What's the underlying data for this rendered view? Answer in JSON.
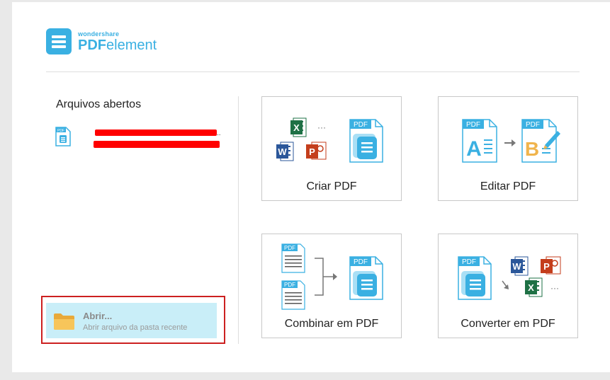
{
  "logo": {
    "brand_sub": "wondershare",
    "brand_main_prefix": "PDF",
    "brand_main_suffix": "element"
  },
  "recent": {
    "title": "Arquivos abertos",
    "file_trailing": ".."
  },
  "open": {
    "label": "Abrir...",
    "subtitle": "Abrir arquivo da pasta recente"
  },
  "cards": [
    {
      "id": "create",
      "label": "Criar PDF"
    },
    {
      "id": "edit",
      "label": "Editar PDF"
    },
    {
      "id": "combine",
      "label": "Combinar em PDF"
    },
    {
      "id": "convert",
      "label": "Converter em PDF"
    }
  ],
  "icons": {
    "pdf_tag": "PDF",
    "excel_letter": "X",
    "word_letter": "W",
    "powerpoint_letter": "P",
    "ellipsis": "···",
    "edit_letter_a": "A",
    "edit_letter_b": "B"
  },
  "colors": {
    "accent": "#3ab0e2",
    "highlight_frame": "#cc2020",
    "open_bg": "#c9eef8",
    "excel": "#1e7145",
    "word": "#2b579a",
    "powerpoint": "#c43e1c",
    "edit_b": "#f0b44c"
  }
}
